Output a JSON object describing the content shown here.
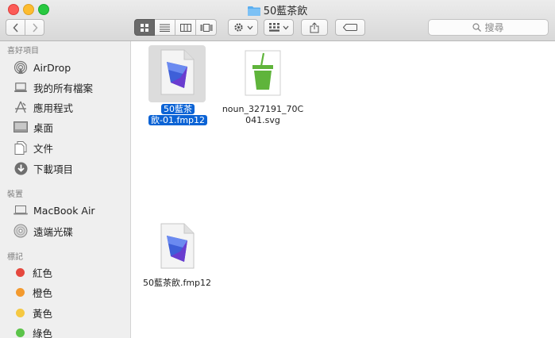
{
  "window": {
    "title": "50藍茶飲"
  },
  "toolbar": {
    "search_placeholder": "搜尋"
  },
  "sidebar": {
    "favorites_title": "喜好項目",
    "favorites": [
      {
        "label": "AirDrop",
        "icon": "airdrop-icon"
      },
      {
        "label": "我的所有檔案",
        "icon": "all-files-icon"
      },
      {
        "label": "應用程式",
        "icon": "applications-icon"
      },
      {
        "label": "桌面",
        "icon": "desktop-icon"
      },
      {
        "label": "文件",
        "icon": "documents-icon"
      },
      {
        "label": "下載項目",
        "icon": "downloads-icon"
      }
    ],
    "devices_title": "裝置",
    "devices": [
      {
        "label": "MacBook Air",
        "icon": "laptop-icon"
      },
      {
        "label": "遠端光碟",
        "icon": "disc-icon"
      }
    ],
    "tags_title": "標記",
    "tags": [
      {
        "label": "紅色",
        "color": "#e5483e"
      },
      {
        "label": "橙色",
        "color": "#f39a2e"
      },
      {
        "label": "黃色",
        "color": "#f5c842"
      },
      {
        "label": "綠色",
        "color": "#5cc44a"
      }
    ]
  },
  "files": [
    {
      "name_line1": "50藍茶",
      "name_line2": "飲-01.fmp12",
      "icon": "filemaker-icon",
      "selected": true
    },
    {
      "name_line1": "noun_327191_70C",
      "name_line2": "041.svg",
      "icon": "svg-drink-icon",
      "selected": false
    },
    {
      "name_line1": "50藍茶飲.fmp12",
      "name_line2": "",
      "icon": "filemaker-icon",
      "selected": false
    }
  ],
  "colors": {
    "selection": "#0b63d5",
    "drink_green": "#5fb43b"
  }
}
